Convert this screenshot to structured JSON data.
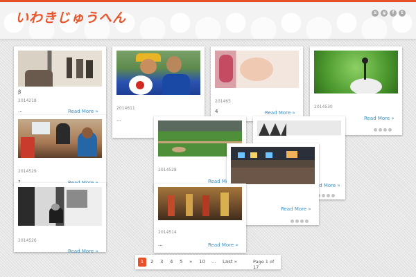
{
  "site": {
    "title": "いわきじゅうへん",
    "accent": "#e8502a",
    "link_color": "#3b8fc0"
  },
  "social_icons": [
    "rss-icon",
    "google-plus-icon",
    "facebook-icon",
    "twitter-icon"
  ],
  "social_labels": [
    "≋",
    "g",
    "f",
    "t"
  ],
  "posts": [
    {
      "date": "2014218",
      "snippet": "β",
      "snippet2": "...",
      "more": "Read More »"
    },
    {
      "date": "2014529",
      "snippet": "?",
      "more": "Read More »"
    },
    {
      "date": "2014526",
      "more": "Read More »"
    },
    {
      "date": "2014611",
      "snippet": "...",
      "more": ""
    },
    {
      "date": "2014528",
      "more": "Read More »"
    },
    {
      "date": "2014514",
      "snippet": "...",
      "more": "Read More »"
    },
    {
      "date": "201465",
      "snippet": "4",
      "more": "Read More »"
    },
    {
      "date": "2014530",
      "more": "Read More »"
    },
    {
      "date": "",
      "more": "Read More »"
    },
    {
      "date": "",
      "more": "Read More »"
    }
  ],
  "pagination": {
    "current": "1",
    "pages": [
      "2",
      "3",
      "4",
      "5"
    ],
    "next": "»",
    "ten": "10",
    "ellipsis": "...",
    "last": "Last »",
    "info": "Page 1 of 17"
  }
}
